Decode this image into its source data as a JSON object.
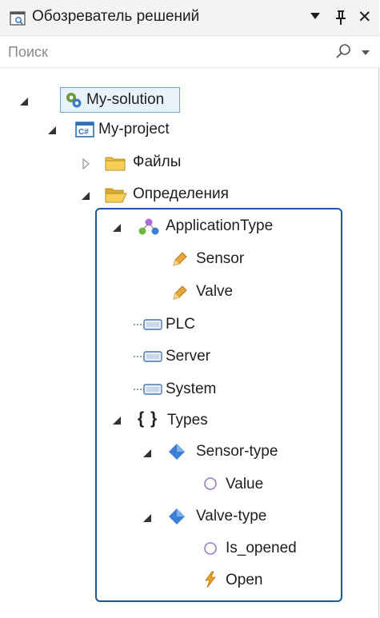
{
  "window": {
    "title": "Обозреватель решений",
    "close_glyph": "✕"
  },
  "search": {
    "placeholder": "Поиск"
  },
  "tree": {
    "root": {
      "label": "My-solution",
      "icon": "solution-icon"
    },
    "project": {
      "label": "My-project",
      "icon": "project-icon"
    },
    "files": {
      "label": "Файлы",
      "icon": "folder-closed-icon"
    },
    "definitions": {
      "label": "Определения",
      "icon": "folder-open-icon"
    },
    "application_type": {
      "label": "ApplicationType",
      "icon": "application-type-icon"
    },
    "sensor": {
      "label": "Sensor",
      "icon": "tag-icon"
    },
    "valve": {
      "label": "Valve",
      "icon": "tag-icon"
    },
    "plc": {
      "label": "PLC",
      "icon": "device-icon"
    },
    "server": {
      "label": "Server",
      "icon": "device-icon"
    },
    "system": {
      "label": "System",
      "icon": "device-icon"
    },
    "types": {
      "label": "Types",
      "icon": "braces-icon",
      "glyph": "{ }"
    },
    "sensor_type": {
      "label": "Sensor-type",
      "icon": "diamond-icon"
    },
    "sensor_value": {
      "label": "Value",
      "icon": "property-circle-icon"
    },
    "valve_type": {
      "label": "Valve-type",
      "icon": "diamond-icon"
    },
    "is_opened": {
      "label": "Is_opened",
      "icon": "property-circle-icon"
    },
    "open": {
      "label": "Open",
      "icon": "lightning-icon"
    }
  },
  "colors": {
    "selection_border": "#6fa6d6",
    "focus_border": "#1c5a9a",
    "diamond": "#3d7fd4",
    "folder": "#f0c040",
    "circle": "#9b7cc4",
    "lightning": "#e8a020"
  }
}
